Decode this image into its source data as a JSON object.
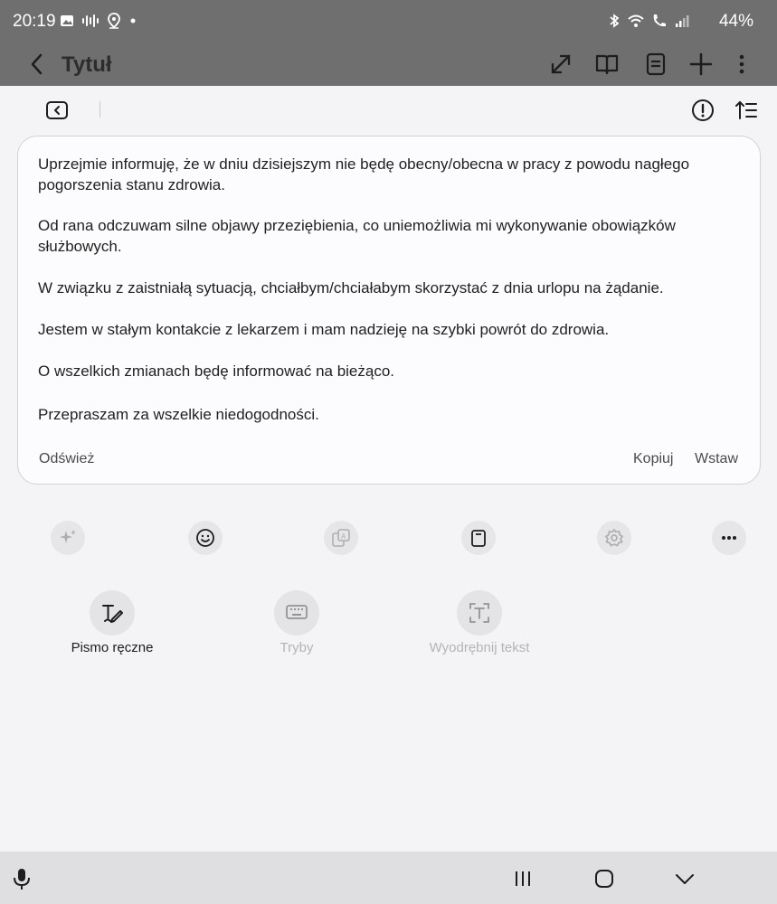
{
  "status_bar": {
    "time": "20:19",
    "battery": "44%",
    "left_icons": [
      "image-icon",
      "voicemail-icon",
      "location-icon",
      "dot-icon"
    ],
    "right_icons": [
      "bluetooth-icon",
      "wifi-icon",
      "wifi-call-icon",
      "signal-icon"
    ]
  },
  "app_bar": {
    "title": "Tytuł",
    "actions": [
      "expand-icon",
      "book-icon",
      "note-icon",
      "plus-icon",
      "more-vert-icon"
    ]
  },
  "text_card": {
    "paragraphs": [
      "Uprzejmie informuję, że w dniu dzisiejszym nie będę obecny/obecna w pracy z powodu nagłego pogorszenia stanu zdrowia.",
      "Od rana odczuwam silne objawy przeziębienia, co uniemożliwia mi wykonywanie obowiązków służbowych.",
      "W związku z zaistniałą sytuacją, chciałbym/chciałabym skorzystać z dnia urlopu na żądanie.",
      "Jestem w stałym kontakcie z lekarzem i mam nadzieję na szybki powrót do zdrowia.",
      "O wszelkich zmianach będę informować na bieżąco.",
      "Przepraszam za wszelkie niedogodności."
    ],
    "refresh_label": "Odśwież",
    "copy_label": "Kopiuj",
    "insert_label": "Wstaw"
  },
  "quick_icons": [
    "sparkle-icon",
    "emoji-icon",
    "translate-icon",
    "clipboard-icon",
    "settings-icon",
    "more-horiz-icon"
  ],
  "tools": [
    {
      "label": "Pismo ręczne",
      "icon": "handwriting-icon",
      "enabled": true
    },
    {
      "label": "Tryby",
      "icon": "keyboard-icon",
      "enabled": false
    },
    {
      "label": "Wyodrębnij tekst",
      "icon": "extract-text-icon",
      "enabled": false
    }
  ],
  "nav_bar": [
    "mic-icon",
    "recents-icon",
    "home-icon",
    "hide-keyboard-icon"
  ]
}
